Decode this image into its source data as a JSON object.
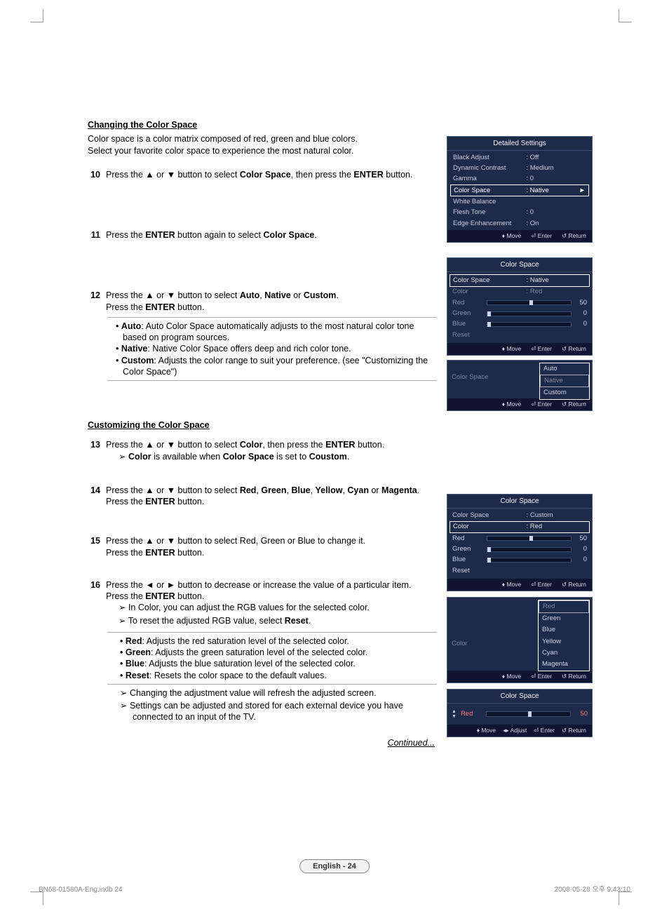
{
  "section1": {
    "heading": "Changing the Color Space",
    "intro1": "Color space is a color matrix composed of red, green and blue colors.",
    "intro2": "Select your favorite color space to experience the most natural color.",
    "step10num": "10",
    "step10a": "Press the ▲ or ▼ button to select ",
    "step10b": "Color Space",
    "step10c": ", then press the ",
    "step10d": "ENTER",
    "step10e": " button.",
    "step11num": "11",
    "step11a": "Press the ",
    "step11b": "ENTER",
    "step11c": " button again to select ",
    "step11d": "Color Space",
    "step11e": ".",
    "step12num": "12",
    "step12a": "Press the ▲ or ▼ button to select ",
    "step12b": "Auto",
    "step12c": ", ",
    "step12d": "Native",
    "step12e": " or ",
    "step12f": "Custom",
    "step12g": ".",
    "step12h": "Press the ",
    "step12i": "ENTER",
    "step12j": " button.",
    "bulA1": "Auto",
    "bulA2": ": Auto Color Space automatically adjusts to the most natural color tone based on program sources.",
    "bulB1": "Native",
    "bulB2": ": Native Color Space offers deep and rich color tone.",
    "bulC1": "Custom",
    "bulC2": ": Adjusts the color range to suit your preference. (see \"Customizing the Color Space\")"
  },
  "section2": {
    "heading": "Customizing the Color Space",
    "step13num": "13",
    "step13a": "Press the ▲ or ▼ button to select ",
    "step13b": "Color",
    "step13c": ", then press the ",
    "step13d": "ENTER",
    "step13e": " button.",
    "sub13a": "Color",
    "sub13b": " is available when ",
    "sub13c": "Color Space",
    "sub13d": " is set to ",
    "sub13e": "Coustom",
    "sub13f": ".",
    "step14num": "14",
    "step14a": "Press the ▲ or ▼ button to select ",
    "step14b": "Red",
    "step14c": ", ",
    "step14d": "Green",
    "step14e": ", ",
    "step14f": "Blue",
    "step14g": ", ",
    "step14h": "Yellow",
    "step14i": ", ",
    "step14j": "Cyan",
    "step14k": " or ",
    "step14l": "Magenta",
    "step14m": ".",
    "step14n": "Press the ",
    "step14o": "ENTER",
    "step14p": " button.",
    "step15num": "15",
    "step15a": "Press the ▲ or ▼ button to select Red, Green or Blue to change it.",
    "step15b": "Press the ",
    "step15c": "ENTER",
    "step15d": " button.",
    "step16num": "16",
    "step16a": "Press the ◄ or ► button to decrease or increase the value of a particular item.",
    "step16b": "Press the ",
    "step16c": "ENTER",
    "step16d": " button.",
    "sub16a": "In Color, you can adjust the RGB values for the selected color.",
    "sub16b": "To reset the adjusted RGB value, select ",
    "sub16c": "Reset",
    "sub16d": ".",
    "d1a": "Red",
    "d1b": ": Adjusts the red saturation level of the selected color.",
    "d2a": "Green",
    "d2b": ": Adjusts the green saturation level of the selected color.",
    "d3a": "Blue",
    "d3b": ": Adjusts the blue saturation level of the selected color.",
    "d4a": "Reset",
    "d4b": ": Resets the color space to the default values.",
    "note1": "Changing the adjustment value will refresh the adjusted screen.",
    "note2": "Settings can be adjusted and stored for each external device you have connected to an input of the TV."
  },
  "continued": "Continued...",
  "pageBadge": "English - 24",
  "footerL": "BN68-01580A-Eng.indb   24",
  "footerR": "2008-05-28   오후 9:43:10",
  "osd1": {
    "title": "Detailed Settings",
    "r1l": "Black Adjust",
    "r1v": ": Off",
    "r2l": "Dynamic Contrast",
    "r2v": ": Medium",
    "r3l": "Gamma",
    "r3v": ": 0",
    "r4l": "Color Space",
    "r4v": ": Native",
    "r4arrow": "►",
    "r5l": "White Balance",
    "r6l": "Flesh Tone",
    "r6v": ": 0",
    "r7l": "Edge Enhancement",
    "r7v": ": On",
    "fMove": "Move",
    "fEnter": "Enter",
    "fReturn": "Return"
  },
  "osd2": {
    "title": "Color Space",
    "r1l": "Color Space",
    "r1v": ": Native",
    "r2l": "Color",
    "r2v": ": Red",
    "s1l": "Red",
    "s1v": "50",
    "s2l": "Green",
    "s2v": "0",
    "s3l": "Blue",
    "s3v": "0",
    "r3l": "Reset",
    "fMove": "Move",
    "fEnter": "Enter",
    "fReturn": "Return"
  },
  "osd3": {
    "leftLabel": "Color Space",
    "opt1": "Auto",
    "opt2": "Native",
    "opt3": "Custom",
    "fMove": "Move",
    "fEnter": "Enter",
    "fReturn": "Return"
  },
  "osd4": {
    "title": "Color Space",
    "r1l": "Color Space",
    "r1v": ": Custom",
    "r2l": "Color",
    "r2v": ": Red",
    "s1l": "Red",
    "s1v": "50",
    "s2l": "Green",
    "s2v": "0",
    "s3l": "Blue",
    "s3v": "0",
    "r3l": "Reset",
    "fMove": "Move",
    "fEnter": "Enter",
    "fReturn": "Return"
  },
  "osd5": {
    "leftLabel": "Color",
    "opt1": "Red",
    "opt2": "Green",
    "opt3": "Blue",
    "opt4": "Yellow",
    "opt5": "Cyan",
    "opt6": "Magenta",
    "fMove": "Move",
    "fEnter": "Enter",
    "fReturn": "Return"
  },
  "osd6": {
    "title": "Color Space",
    "label": "Red",
    "val": "50",
    "fMove": "Move",
    "fAdjust": "Adjust",
    "fEnter": "Enter",
    "fReturn": "Return"
  }
}
